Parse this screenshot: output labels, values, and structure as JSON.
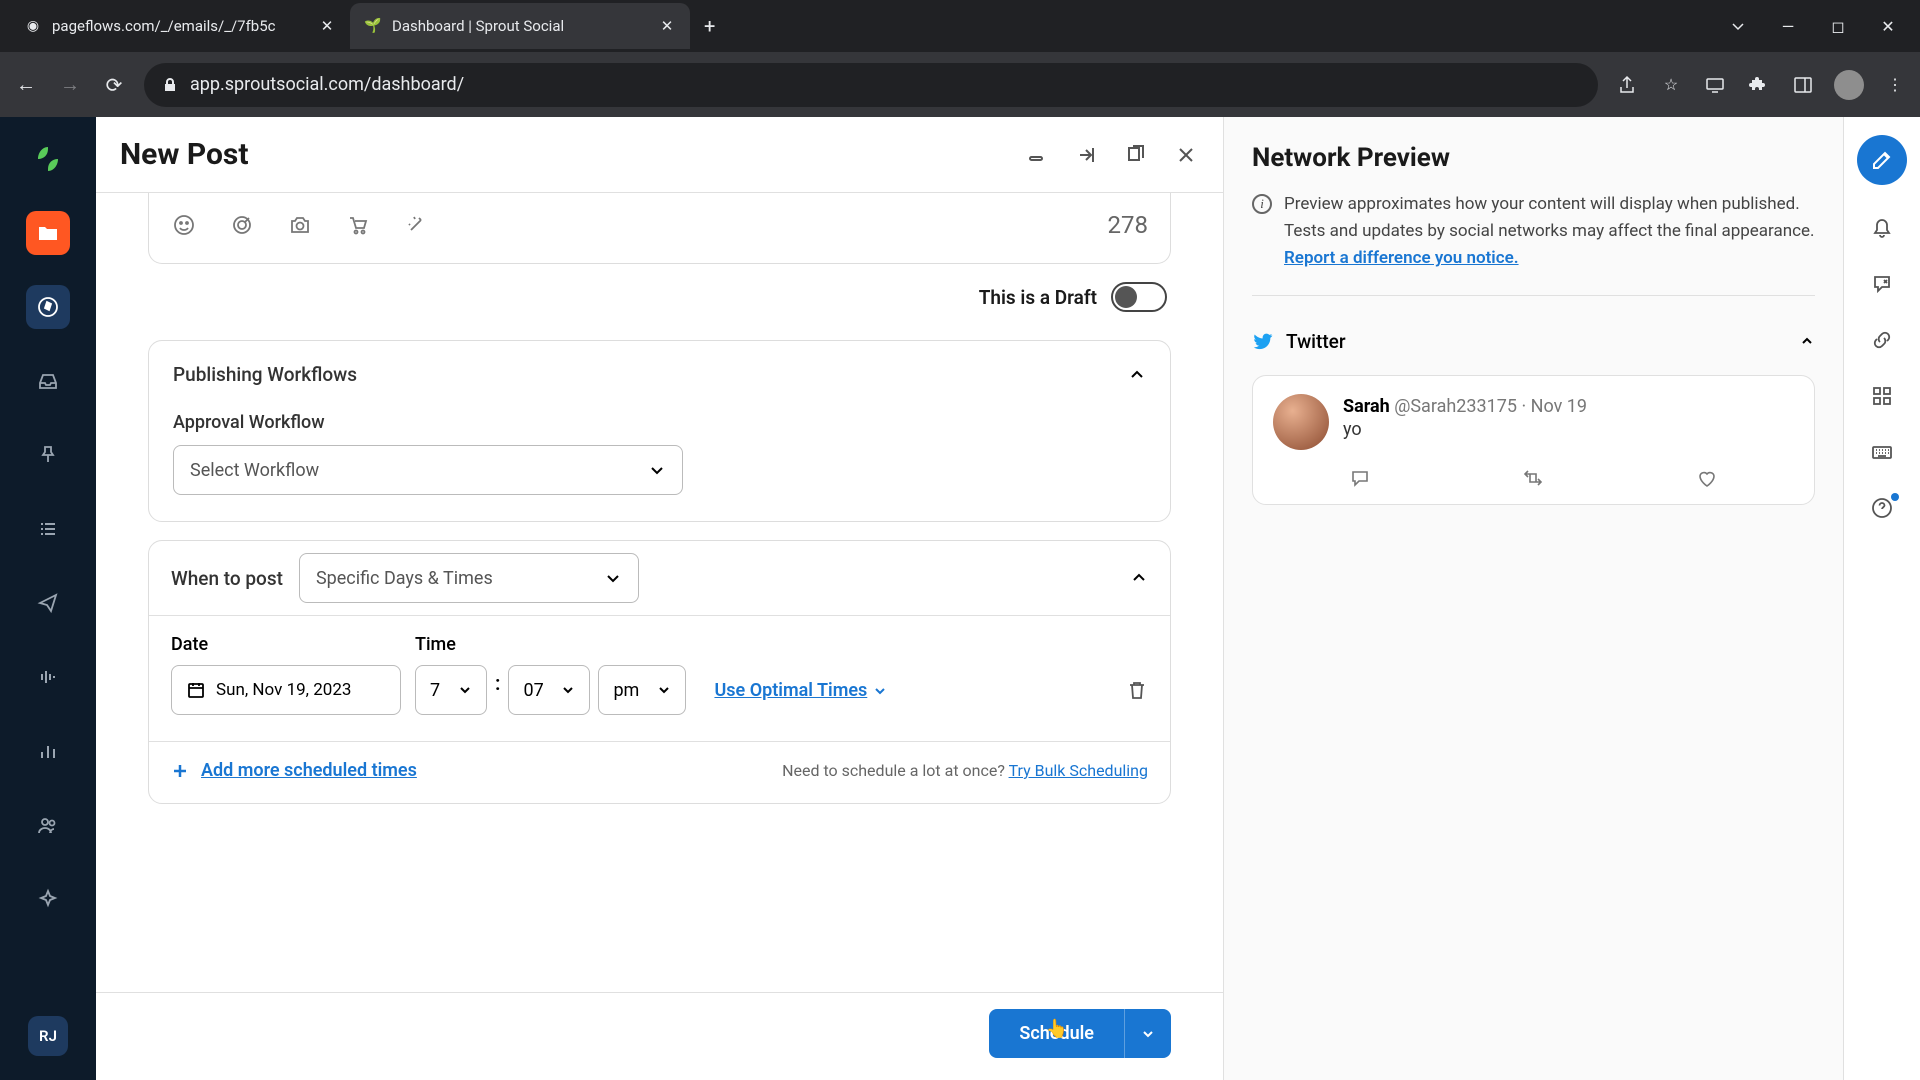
{
  "browser": {
    "tabs": [
      {
        "title": "pageflows.com/_/emails/_/7fb5c",
        "favicon": "◎"
      },
      {
        "title": "Dashboard | Sprout Social",
        "favicon": "🌱"
      }
    ],
    "url": "app.sproutsocial.com/dashboard/"
  },
  "header": {
    "title": "New Post"
  },
  "composer": {
    "char_count": "278",
    "draft_label": "This is a Draft"
  },
  "workflows": {
    "section_title": "Publishing Workflows",
    "approval_label": "Approval Workflow",
    "select_placeholder": "Select Workflow"
  },
  "when": {
    "label": "When to post",
    "mode": "Specific Days & Times",
    "date_label": "Date",
    "time_label": "Time",
    "date_value": "Sun, Nov 19, 2023",
    "hour": "7",
    "minute": "07",
    "ampm": "pm",
    "optimal_link": "Use Optimal Times",
    "add_more": "Add more scheduled times",
    "bulk_q": "Need to schedule a lot at once? ",
    "bulk_link": "Try Bulk Scheduling"
  },
  "footer": {
    "schedule_label": "Schedule"
  },
  "preview": {
    "title": "Network Preview",
    "note_pre": "Preview approximates how your content will display when published. Tests and updates by social networks may affect the final appearance. ",
    "report_link": "Report a difference you notice.",
    "twitter_label": "Twitter",
    "tweet": {
      "name": "Sarah",
      "handle": "@Sarah233175",
      "date": "Nov 19",
      "body": "yo"
    }
  },
  "left_nav_user": "RJ"
}
